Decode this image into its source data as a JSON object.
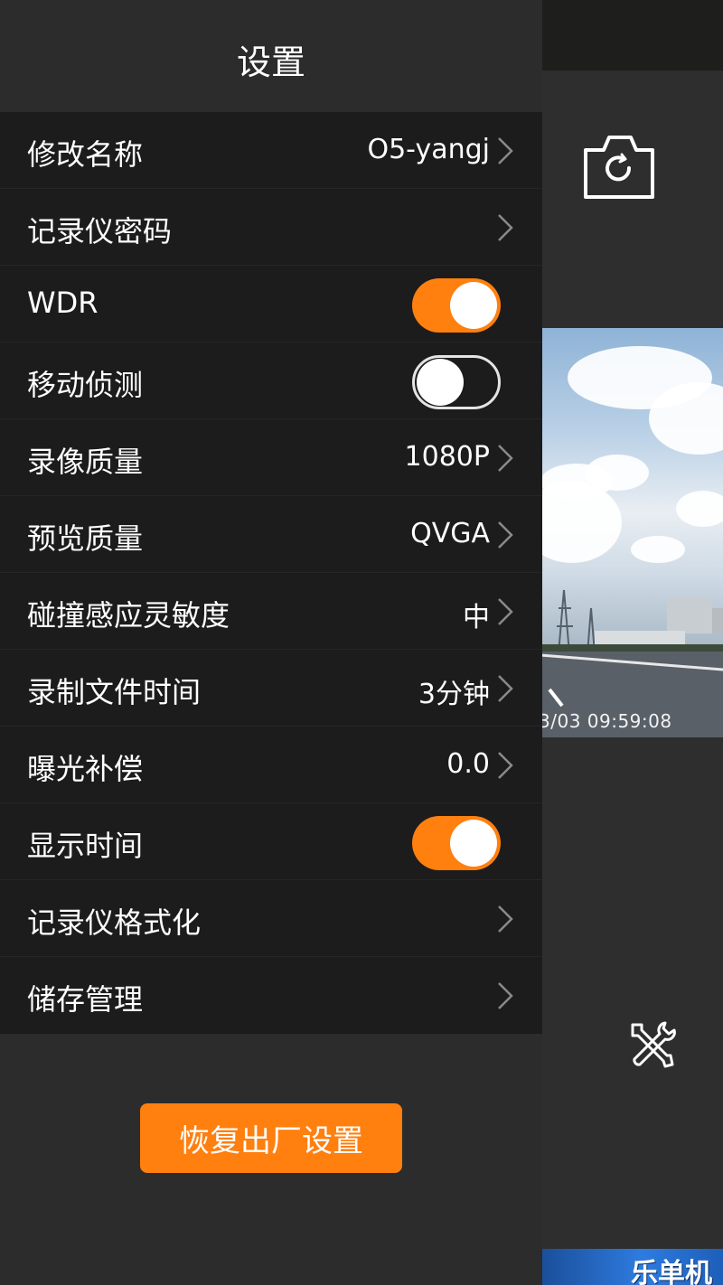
{
  "header": {
    "title": "设置"
  },
  "settings": {
    "rows": [
      {
        "label": "修改名称",
        "value": "O5-yangj"
      },
      {
        "label": "记录仪密码",
        "value": ""
      },
      {
        "label": "WDR",
        "toggle": "on"
      },
      {
        "label": "移动侦测",
        "toggle": "off"
      },
      {
        "label": "录像质量",
        "value": "1080P"
      },
      {
        "label": "预览质量",
        "value": "QVGA"
      },
      {
        "label": "碰撞感应灵敏度",
        "value": "中"
      },
      {
        "label": "录制文件时间",
        "value": "3分钟"
      },
      {
        "label": "曝光补偿",
        "value": "0.0"
      },
      {
        "label": "显示时间",
        "toggle": "on"
      },
      {
        "label": "记录仪格式化",
        "value": ""
      },
      {
        "label": "储存管理",
        "value": ""
      }
    ]
  },
  "reset_button": {
    "label": "恢复出厂设置"
  },
  "preview": {
    "timestamp": "3/03  09:59:08"
  },
  "watermark": {
    "text": "乐单机"
  },
  "colors": {
    "accent": "#ff7f0f",
    "list_bg": "#1c1c1c",
    "panel_bg": "#2c2c2c"
  },
  "icons": {
    "camera": "camera-switch-icon",
    "tools": "tools-icon",
    "chevron": "chevron-right-icon"
  }
}
